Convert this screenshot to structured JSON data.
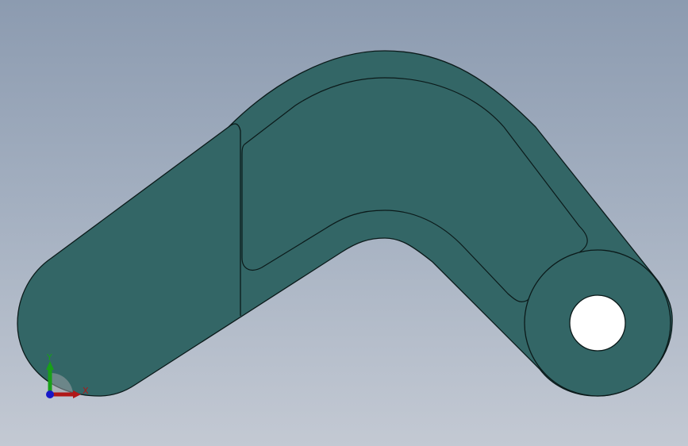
{
  "viewport": {
    "background_top": "#8c9bb0",
    "background_bottom": "#c3c9d3"
  },
  "part": {
    "body_color": "#336666",
    "edge_color": "#0b1a1a",
    "hole_color": "#ffffff",
    "features": [
      "bent-arm-body",
      "pocket-recess",
      "boss-end",
      "through-hole"
    ]
  },
  "triad": {
    "x_label": "X",
    "y_label": "Y",
    "x_color": "#b01818",
    "y_color": "#18a018",
    "z_color": "#1818c8",
    "icon": "coordinate-triad-icon"
  }
}
